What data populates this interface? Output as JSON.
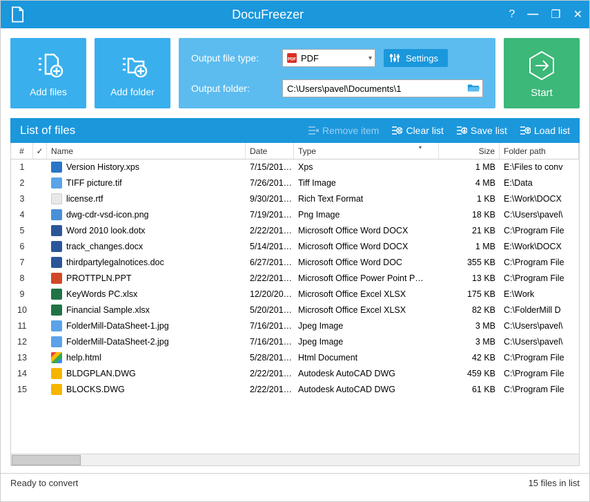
{
  "titlebar": {
    "title": "DocuFreezer"
  },
  "toolbar": {
    "add_files_label": "Add files",
    "add_folder_label": "Add folder",
    "output_type_label": "Output file type:",
    "output_type_value": "PDF",
    "settings_label": "Settings",
    "output_folder_label": "Output folder:",
    "output_folder_value": "C:\\Users\\pavel\\Documents\\1",
    "start_label": "Start"
  },
  "list": {
    "header_title": "List of files",
    "actions": {
      "remove": "Remove item",
      "clear": "Clear list",
      "save": "Save list",
      "load": "Load list"
    },
    "columns": {
      "num": "#",
      "name": "Name",
      "date": "Date",
      "type": "Type",
      "size": "Size",
      "path": "Folder path"
    },
    "rows": [
      {
        "n": "1",
        "name": "Version History.xps",
        "date": "7/15/201…",
        "type": "Xps",
        "size": "1 MB",
        "path": "E:\\Files to conv",
        "ico": "ico-xps"
      },
      {
        "n": "2",
        "name": "TIFF picture.tif",
        "date": "7/26/201…",
        "type": "Tiff Image",
        "size": "4 MB",
        "path": "E:\\Data",
        "ico": "ico-tif"
      },
      {
        "n": "3",
        "name": "license.rtf",
        "date": "9/30/201…",
        "type": "Rich Text Format",
        "size": "1 KB",
        "path": "E:\\Work\\DOCX",
        "ico": "ico-rtf"
      },
      {
        "n": "4",
        "name": "dwg-cdr-vsd-icon.png",
        "date": "7/19/201…",
        "type": "Png Image",
        "size": "18 KB",
        "path": "C:\\Users\\pavel\\",
        "ico": "ico-png"
      },
      {
        "n": "5",
        "name": "Word 2010 look.dotx",
        "date": "2/22/201…",
        "type": "Microsoft Office Word DOCX",
        "size": "21 KB",
        "path": "C:\\Program File",
        "ico": "ico-docx"
      },
      {
        "n": "6",
        "name": "track_changes.docx",
        "date": "5/14/201…",
        "type": "Microsoft Office Word DOCX",
        "size": "1 MB",
        "path": "E:\\Work\\DOCX",
        "ico": "ico-docx"
      },
      {
        "n": "7",
        "name": "thirdpartylegalnotices.doc",
        "date": "6/27/201…",
        "type": "Microsoft Office Word DOC",
        "size": "355 KB",
        "path": "C:\\Program File",
        "ico": "ico-doc"
      },
      {
        "n": "8",
        "name": "PROTTPLN.PPT",
        "date": "2/22/201…",
        "type": "Microsoft Office Power Point P…",
        "size": "13 KB",
        "path": "C:\\Program File",
        "ico": "ico-ppt"
      },
      {
        "n": "9",
        "name": "KeyWords PC.xlsx",
        "date": "12/20/20…",
        "type": "Microsoft Office Excel XLSX",
        "size": "175 KB",
        "path": "E:\\Work",
        "ico": "ico-xlsx"
      },
      {
        "n": "10",
        "name": "Financial Sample.xlsx",
        "date": "5/20/201…",
        "type": "Microsoft Office Excel XLSX",
        "size": "82 KB",
        "path": "C:\\FolderMill D",
        "ico": "ico-xlsx"
      },
      {
        "n": "11",
        "name": "FolderMill-DataSheet-1.jpg",
        "date": "7/16/201…",
        "type": "Jpeg Image",
        "size": "3 MB",
        "path": "C:\\Users\\pavel\\",
        "ico": "ico-jpg"
      },
      {
        "n": "12",
        "name": "FolderMill-DataSheet-2.jpg",
        "date": "7/16/201…",
        "type": "Jpeg Image",
        "size": "3 MB",
        "path": "C:\\Users\\pavel\\",
        "ico": "ico-jpg"
      },
      {
        "n": "13",
        "name": "help.html",
        "date": "5/28/201…",
        "type": "Html Document",
        "size": "42 KB",
        "path": "C:\\Program File",
        "ico": "ico-html"
      },
      {
        "n": "14",
        "name": "BLDGPLAN.DWG",
        "date": "2/22/201…",
        "type": "Autodesk AutoCAD DWG",
        "size": "459 KB",
        "path": "C:\\Program File",
        "ico": "ico-dwg"
      },
      {
        "n": "15",
        "name": "BLOCKS.DWG",
        "date": "2/22/201…",
        "type": "Autodesk AutoCAD DWG",
        "size": "61 KB",
        "path": "C:\\Program File",
        "ico": "ico-dwg"
      }
    ]
  },
  "status": {
    "left": "Ready to convert",
    "right": "15 files in list"
  }
}
